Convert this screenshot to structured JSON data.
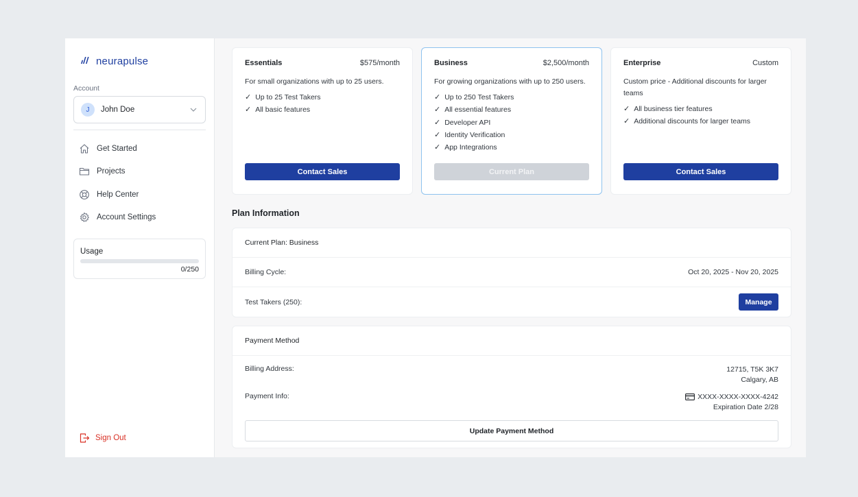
{
  "brand": {
    "mark": "///",
    "name": "neurapulse"
  },
  "sidebar": {
    "account_label": "Account",
    "account": {
      "initial": "J",
      "name": "John Doe"
    },
    "nav": [
      {
        "label": "Get Started",
        "icon": "home-icon"
      },
      {
        "label": "Projects",
        "icon": "folder-icon"
      },
      {
        "label": "Help Center",
        "icon": "lifebuoy-icon"
      },
      {
        "label": "Account Settings",
        "icon": "gear-icon"
      }
    ],
    "usage": {
      "title": "Usage",
      "count": "0/250",
      "fraction": 0
    },
    "sign_out": "Sign Out"
  },
  "plans": [
    {
      "name": "Essentials",
      "price": "$575/month",
      "description": "For small organizations with up to 25 users.",
      "features": [
        "Up to 25 Test Takers",
        "All basic features"
      ],
      "button": "Contact Sales"
    },
    {
      "name": "Business",
      "price": "$2,500/month",
      "description": "For growing organizations with up to 250 users.",
      "features": [
        "Up to 250 Test Takers",
        "All essential features",
        "Developer API",
        "Identity Verification",
        "App Integrations"
      ],
      "button": "Current Plan"
    },
    {
      "name": "Enterprise",
      "price": "Custom",
      "description": "Custom price - Additional discounts for larger teams",
      "features": [
        "All business tier features",
        "Additional discounts for larger teams"
      ],
      "button": "Contact Sales"
    }
  ],
  "plan_info": {
    "title": "Plan Information",
    "current_plan": "Current Plan: Business",
    "billing_cycle_label": "Billing Cycle:",
    "billing_cycle_value": "Oct 20, 2025 - Nov 20, 2025",
    "test_takers_label": "Test Takers (250):",
    "manage_label": "Manage"
  },
  "payment": {
    "title": "Payment Method",
    "billing_address_label": "Billing Address:",
    "billing_address_line1": "12715,  T5K 3K7",
    "billing_address_line2": "Calgary, AB",
    "payment_info_label": "Payment Info:",
    "card_number": "XXXX-XXXX-XXXX-4242",
    "expiration": "Expiration Date 2/28",
    "update_label": "Update Payment Method"
  },
  "colors": {
    "accent": "#1f3fa0",
    "danger": "#d93025",
    "selected_border": "#8ec2ee"
  }
}
